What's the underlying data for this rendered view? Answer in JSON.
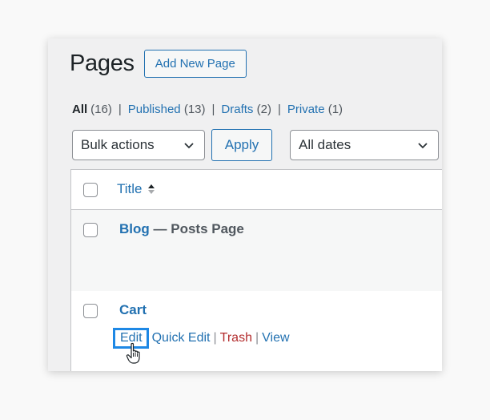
{
  "header": {
    "title": "Pages",
    "add_new_label": "Add New Page"
  },
  "views": {
    "all": {
      "label": "All",
      "count": "(16)"
    },
    "published": {
      "label": "Published",
      "count": "(13)"
    },
    "drafts": {
      "label": "Drafts",
      "count": "(2)"
    },
    "private": {
      "label": "Private",
      "count": "(1)"
    },
    "separator": "|"
  },
  "filters": {
    "bulk_actions": "Bulk actions",
    "apply_label": "Apply",
    "dates": "All dates"
  },
  "table": {
    "column_title": "Title",
    "rows": [
      {
        "title": "Blog",
        "suffix": " — Posts Page"
      },
      {
        "title": "Cart",
        "actions": {
          "edit": "Edit",
          "quick_edit": "Quick Edit",
          "trash": "Trash",
          "view": "View",
          "separator": "|"
        }
      }
    ]
  },
  "colors": {
    "accent": "#2271b1",
    "trash": "#b32d2e",
    "highlight": "#1e88e5"
  }
}
